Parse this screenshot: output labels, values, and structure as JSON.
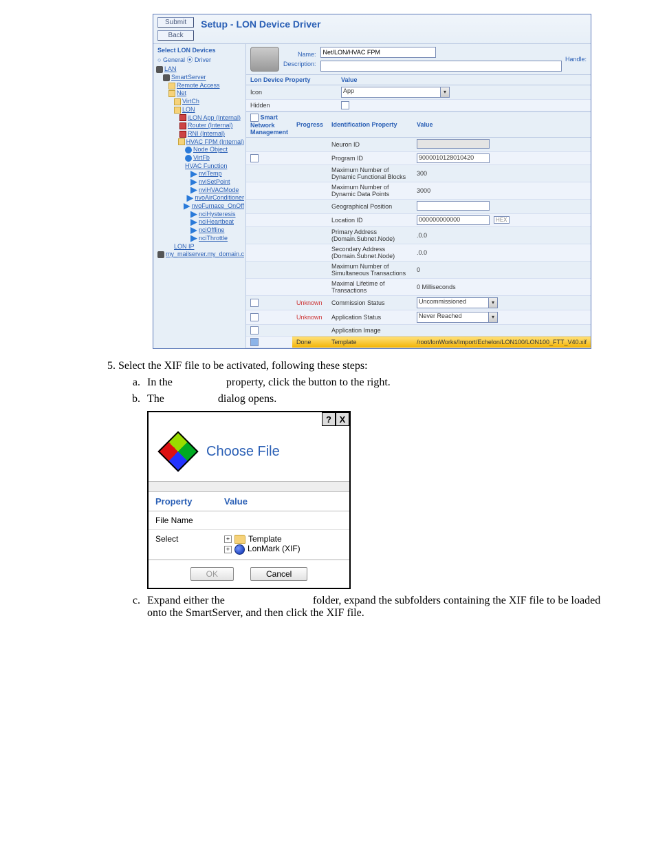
{
  "fig1": {
    "submit": "Submit",
    "back": "Back",
    "title": "Setup - LON Device Driver",
    "name_lbl": "Name:",
    "desc_lbl": "Description:",
    "handle_lbl": "Handle:",
    "name_val": "Net/LON/HVAC FPM",
    "nav": {
      "hdr": "Select LON Devices",
      "opt_general": "General",
      "opt_driver": "Driver",
      "items": [
        "LAN",
        "SmartServer",
        "Remote Access",
        "Net",
        "VirtCh",
        "LON",
        "iLON App (Internal)",
        "Router (Internal)",
        "RNI (Internal)",
        "HVAC FPM (Internal)",
        "Node Object",
        "VirtFb",
        "HVAC Function",
        "nviTemp",
        "nviSetPoint",
        "nviHVACMode",
        "nvoAirConditioner",
        "nvoFurnace_OnOff",
        "nciHysteresis",
        "nciHeartbeat",
        "nciOffline",
        "nciThrottle",
        "LON IP",
        "my_mailserver.my_domain.com"
      ]
    },
    "tblA": {
      "h1": "Lon Device Property",
      "h2": "Value",
      "rows": [
        {
          "k": "Icon",
          "v": "App",
          "sel": true
        },
        {
          "k": "Hidden",
          "v": "",
          "chk": true
        }
      ]
    },
    "tblB": {
      "h0": "Smart Network Management",
      "h1": "Progress",
      "h2": "Identification Property",
      "h3": "Value",
      "rows": [
        {
          "p": "",
          "k": "Neuron ID",
          "v": "",
          "ro": true
        },
        {
          "p": "",
          "k": "Program ID",
          "v": "9000010128010420",
          "inp": true,
          "chk": true
        },
        {
          "p": "",
          "k": "Maximum Number of Dynamic Functional Blocks",
          "v": "300"
        },
        {
          "p": "",
          "k": "Maximum Number of Dynamic Data Points",
          "v": "3000"
        },
        {
          "p": "",
          "k": "Geographical Position",
          "v": "",
          "inp": true
        },
        {
          "p": "",
          "k": "Location ID",
          "v": "000000000000",
          "inp": true,
          "hex": true
        },
        {
          "p": "",
          "k": "Primary Address (Domain.Subnet.Node)",
          "v": ".0.0"
        },
        {
          "p": "",
          "k": "Secondary Address (Domain.Subnet.Node)",
          "v": ".0.0"
        },
        {
          "p": "",
          "k": "Maximum Number of Simultaneous Transactions",
          "v": "0"
        },
        {
          "p": "",
          "k": "Maximal Lifetime of Transactions",
          "v": "0 Milliseconds"
        },
        {
          "p": "Unknown",
          "k": "Commission Status",
          "v": "Uncommissioned",
          "sel": true,
          "chk": true
        },
        {
          "p": "Unknown",
          "k": "Application Status",
          "v": "Never Reached",
          "sel": true,
          "chk": true
        },
        {
          "p": "",
          "k": "Application Image",
          "v": "",
          "chk": true
        },
        {
          "p": "Done",
          "k": "Template",
          "v": "/root/lonWorks/Import/Echelon/LON100/LON100_FTT_V40.xif",
          "done": true,
          "chk": true,
          "chkon": true
        }
      ]
    },
    "hex_lbl": "HEX"
  },
  "steps": {
    "n5": "Select the XIF file to be activated, following these steps:",
    "a": {
      "pre": "In the ",
      "post": " property, click the button to the right."
    },
    "b": {
      "pre": "The ",
      "post": " dialog opens."
    },
    "c": {
      "pre": "Expand either the ",
      "post": " folder, expand the subfolders containing the XIF file to be loaded onto the SmartServer, and then click the XIF file."
    }
  },
  "dialog": {
    "title": "Choose File",
    "th1": "Property",
    "th2": "Value",
    "r1": "File Name",
    "r2": "Select",
    "opt1": "Template",
    "opt2": "LonMark (XIF)",
    "ok": "OK",
    "cancel": "Cancel",
    "help": "?",
    "close": "X"
  }
}
